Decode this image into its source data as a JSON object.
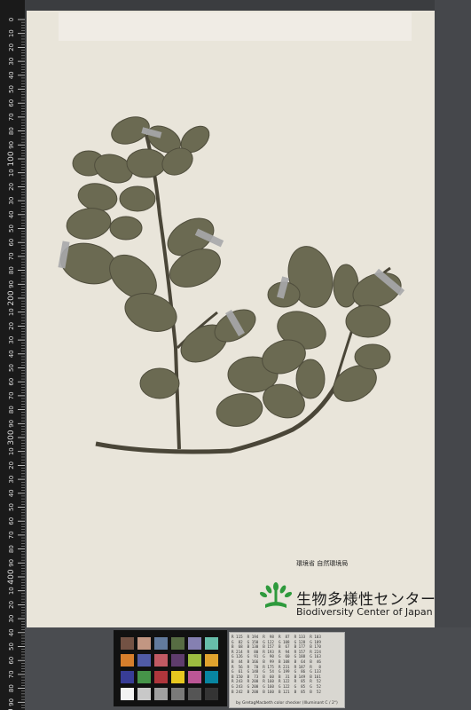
{
  "ruler": {
    "labels": [
      "0",
      "10",
      "20",
      "30",
      "40",
      "50",
      "60",
      "70",
      "80",
      "90",
      "100",
      "10",
      "20",
      "30",
      "40",
      "50",
      "60",
      "70",
      "80",
      "90",
      "200",
      "10",
      "20",
      "30",
      "40",
      "50",
      "60",
      "70",
      "80",
      "90",
      "300",
      "10",
      "20",
      "30",
      "40",
      "50",
      "60",
      "70",
      "80",
      "90",
      "400",
      "10",
      "20",
      "30",
      "40",
      "50",
      "60",
      "70",
      "80",
      "90",
      "500"
    ]
  },
  "institution": {
    "ministry": "環境省 自然環境局",
    "name_jp": "生物多様性センター",
    "name_en": "Biodiversity Center of Japan"
  },
  "colors": {
    "sheet": "#e9e5da",
    "leaf": "#6b6a52",
    "stem": "#4a4638",
    "background": "#3b3d40"
  },
  "color_card": {
    "swatches": [
      "#735244",
      "#c29682",
      "#627a9d",
      "#576c43",
      "#8580b1",
      "#67bdaa",
      "#d67e2c",
      "#505ba6",
      "#c15a63",
      "#5e3c6c",
      "#9dbc40",
      "#e0a32e",
      "#383d96",
      "#469449",
      "#af363c",
      "#e7c71f",
      "#bb5695",
      "#0885a1",
      "#f3f3f2",
      "#c8c8c8",
      "#a0a0a0",
      "#7a7a79",
      "#555555",
      "#343434"
    ]
  },
  "data_card": {
    "rows": [
      "R 115  R 194  R  98  R  87  R 133  R 103",
      "G  82  G 150  G 122  G 108  G 128  G 189",
      "B  68  B 130  B 157  B  67  B 177  B 170",
      "R 214  R  80  R 193  R  94  R 157  R 224",
      "G 126  G  91  G  90  G  60  G 188  G 163",
      "B  44  B 166  B  99  B 108  B  64  B  46",
      "R  56  R  70  R 175  R 231  R 187  R   8",
      "G  61  G 148  G  54  G 199  G  86  G 133",
      "B 150  B  73  B  60  B  31  B 149  B 161",
      "R 243  R 200  R 160  R 122  R  85  R  52",
      "G 243  G 200  G 160  G 122  G  85  G  52",
      "B 242  B 200  B 160  B 121  B  85  B  52"
    ],
    "credit": "by GretagMacbeth color checker  (Illuminant C / 2°)"
  }
}
